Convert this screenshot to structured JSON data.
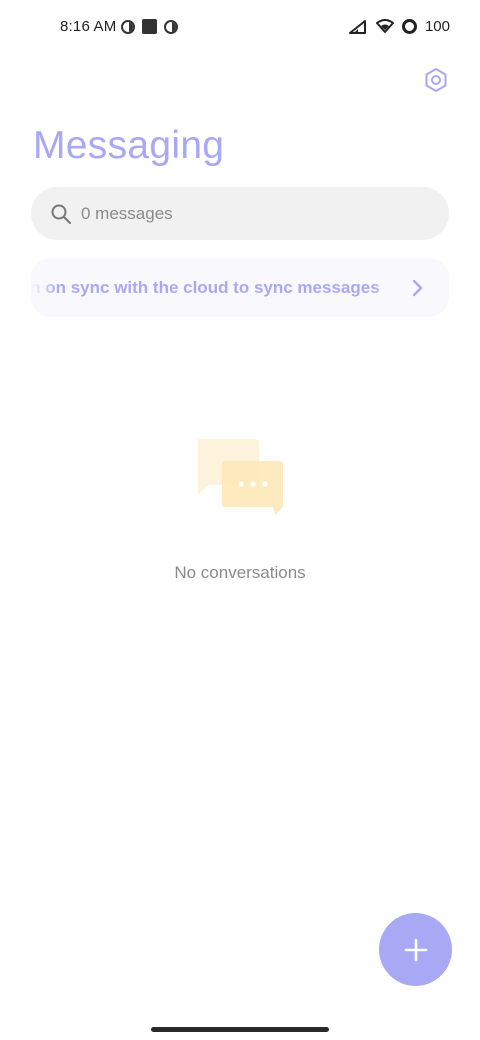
{
  "status_bar": {
    "time": "8:16 AM",
    "battery": "100"
  },
  "header": {
    "title": "Messaging"
  },
  "search": {
    "placeholder": "0 messages"
  },
  "sync_banner": {
    "text": "Turn on sync with the cloud to sync messages"
  },
  "empty_state": {
    "text": "No conversations"
  },
  "colors": {
    "accent": "#a9a8f4",
    "illustration": "#fde9b8"
  },
  "icons": {
    "settings": "gear-icon",
    "search": "search-icon",
    "chevron": "chevron-right-icon",
    "fab": "plus-icon"
  }
}
